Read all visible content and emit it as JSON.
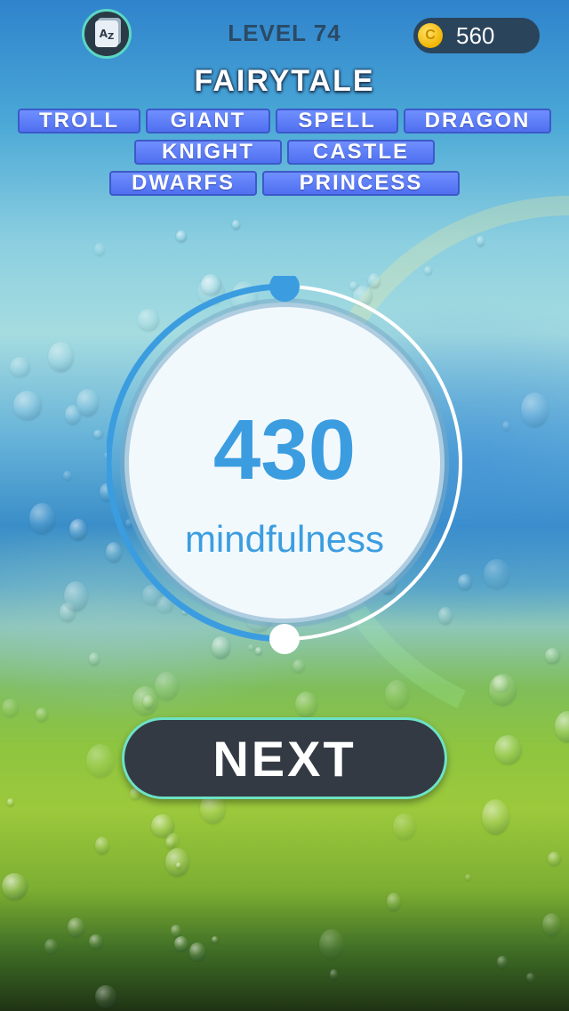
{
  "header": {
    "level_text": "LEVEL 74",
    "coins": "560",
    "icons": {
      "dictionary": "az-book-icon",
      "coin": "coin-icon"
    }
  },
  "puzzle": {
    "category": "FAIRYTALE",
    "word_rows": [
      [
        "TROLL",
        "GIANT",
        "SPELL",
        "DRAGON"
      ],
      [
        "KNIGHT",
        "CASTLE"
      ],
      [
        "DWARFS",
        "PRINCESS"
      ]
    ]
  },
  "result": {
    "score": "430",
    "label": "mindfulness",
    "progress_fraction": 0.5
  },
  "actions": {
    "next_label": "NEXT"
  },
  "colors": {
    "accent_blue": "#3b9de0",
    "word_tile": "#5b7bf6",
    "button_dark": "#333a44",
    "button_border": "#6ee2c6",
    "coin_gold": "#f0b400"
  }
}
